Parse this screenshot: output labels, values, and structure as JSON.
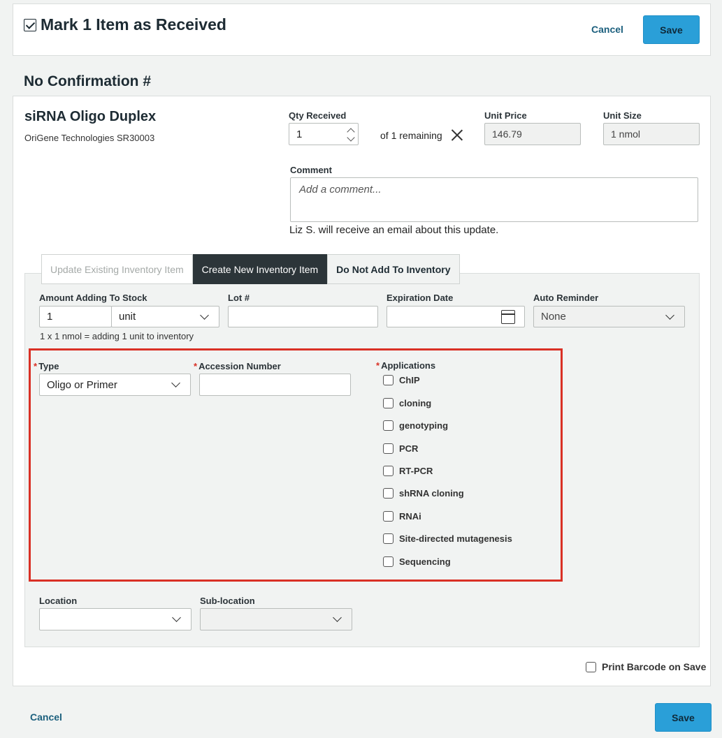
{
  "header": {
    "title": "Mark 1 Item as Received",
    "cancel_label": "Cancel",
    "save_label": "Save"
  },
  "confirmation": "No Confirmation #",
  "product": {
    "name": "siRNA Oligo Duplex",
    "vendor": "OriGene Technologies SR30003"
  },
  "qty": {
    "label": "Qty Received",
    "value": "1",
    "remaining": "of 1 remaining"
  },
  "unit_price": {
    "label": "Unit Price",
    "value": "146.79"
  },
  "unit_size": {
    "label": "Unit Size",
    "value": "1 nmol"
  },
  "comment": {
    "label": "Comment",
    "placeholder": "Add a comment...",
    "notice": "Liz S. will receive an email about this update."
  },
  "tabs": [
    {
      "label": "Update Existing Inventory Item"
    },
    {
      "label": "Create New Inventory Item"
    },
    {
      "label": "Do Not Add To Inventory"
    }
  ],
  "inventory": {
    "amount_label": "Amount Adding To Stock",
    "amount_value": "1",
    "amount_unit": "unit",
    "lot_label": "Lot #",
    "expiration_label": "Expiration Date",
    "reminder_label": "Auto Reminder",
    "reminder_value": "None",
    "hint": "1 x 1 nmol = adding 1 unit to inventory"
  },
  "required_star": "*",
  "type": {
    "label": "Type",
    "value": "Oligo or Primer"
  },
  "accession": {
    "label": "Accession Number"
  },
  "applications": {
    "label": "Applications",
    "items": [
      "ChIP",
      "cloning",
      "genotyping",
      "PCR",
      "RT-PCR",
      "shRNA cloning",
      "RNAi",
      "Site-directed mutagenesis",
      "Sequencing"
    ]
  },
  "location": {
    "label": "Location",
    "sub_label": "Sub-location"
  },
  "print_barcode": "Print Barcode on Save",
  "footer": {
    "cancel_label": "Cancel",
    "save_label": "Save"
  }
}
